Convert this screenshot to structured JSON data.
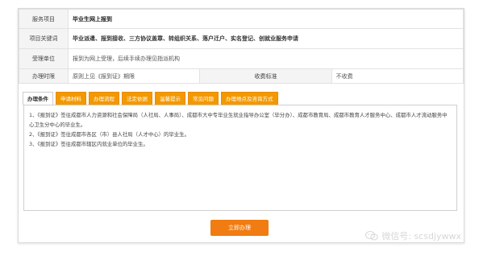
{
  "service": {
    "item_label": "服务项目",
    "item_value": "毕业生网上报到",
    "keywords_label": "项目关键词",
    "keywords_value": "毕业派遣、报到接收、三方协议盖章、转组织关系、落户迁户、实名登记、创就业服务申请",
    "accept_label": "受理单位",
    "accept_value": "报到为网上受理，后续手续办理见指派机构",
    "time_label": "办理时限",
    "time_value": "原则上见《报到证》期限",
    "fee_label": "收费标准",
    "fee_value": "不收费"
  },
  "tabs": [
    {
      "label": "办理条件",
      "active": true
    },
    {
      "label": "申请材料",
      "active": false
    },
    {
      "label": "办理流程",
      "active": false
    },
    {
      "label": "法定依据",
      "active": false
    },
    {
      "label": "温馨提示",
      "active": false
    },
    {
      "label": "常见问题",
      "active": false
    },
    {
      "label": "办理地点及咨询方式",
      "active": false
    }
  ],
  "content": {
    "line1": "1、《报到证》签往成都市人力资源和社会保障局（人社局、人事局）、成都市大中专毕业生就业指导办公室（毕分办）、成都市教育局、成都市教育人才服务中心、成都市人才流动服务中心卫生分中心的毕业生。",
    "line2": "2、《报到证》签往成都市各区（市）县人社局（人才中心）的毕业生。",
    "line3": "3、《报到证》签往成都市辖区内就业单位的毕业生。"
  },
  "action": {
    "submit_label": "立即办理"
  },
  "watermark": {
    "text": "微信号: scsdjywwx",
    "icon": "wechat-icon"
  },
  "colors": {
    "tab": "#f39800",
    "button": "#f07c12"
  }
}
